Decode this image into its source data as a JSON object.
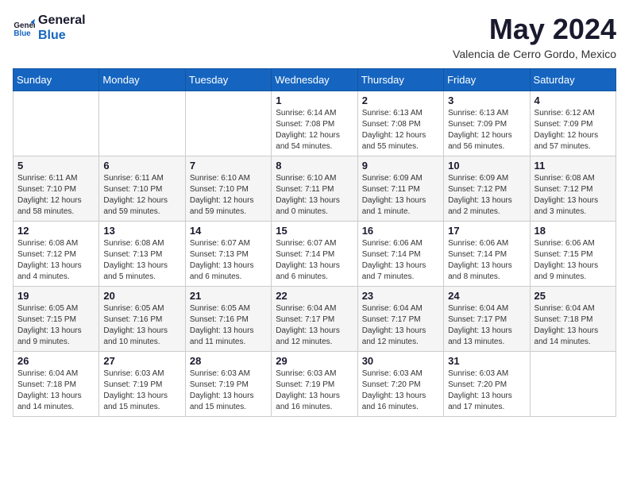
{
  "header": {
    "logo_line1": "General",
    "logo_line2": "Blue",
    "month_title": "May 2024",
    "location": "Valencia de Cerro Gordo, Mexico"
  },
  "days_of_week": [
    "Sunday",
    "Monday",
    "Tuesday",
    "Wednesday",
    "Thursday",
    "Friday",
    "Saturday"
  ],
  "weeks": [
    [
      {
        "day": "",
        "info": ""
      },
      {
        "day": "",
        "info": ""
      },
      {
        "day": "",
        "info": ""
      },
      {
        "day": "1",
        "info": "Sunrise: 6:14 AM\nSunset: 7:08 PM\nDaylight: 12 hours\nand 54 minutes."
      },
      {
        "day": "2",
        "info": "Sunrise: 6:13 AM\nSunset: 7:08 PM\nDaylight: 12 hours\nand 55 minutes."
      },
      {
        "day": "3",
        "info": "Sunrise: 6:13 AM\nSunset: 7:09 PM\nDaylight: 12 hours\nand 56 minutes."
      },
      {
        "day": "4",
        "info": "Sunrise: 6:12 AM\nSunset: 7:09 PM\nDaylight: 12 hours\nand 57 minutes."
      }
    ],
    [
      {
        "day": "5",
        "info": "Sunrise: 6:11 AM\nSunset: 7:10 PM\nDaylight: 12 hours\nand 58 minutes."
      },
      {
        "day": "6",
        "info": "Sunrise: 6:11 AM\nSunset: 7:10 PM\nDaylight: 12 hours\nand 59 minutes."
      },
      {
        "day": "7",
        "info": "Sunrise: 6:10 AM\nSunset: 7:10 PM\nDaylight: 12 hours\nand 59 minutes."
      },
      {
        "day": "8",
        "info": "Sunrise: 6:10 AM\nSunset: 7:11 PM\nDaylight: 13 hours\nand 0 minutes."
      },
      {
        "day": "9",
        "info": "Sunrise: 6:09 AM\nSunset: 7:11 PM\nDaylight: 13 hours\nand 1 minute."
      },
      {
        "day": "10",
        "info": "Sunrise: 6:09 AM\nSunset: 7:12 PM\nDaylight: 13 hours\nand 2 minutes."
      },
      {
        "day": "11",
        "info": "Sunrise: 6:08 AM\nSunset: 7:12 PM\nDaylight: 13 hours\nand 3 minutes."
      }
    ],
    [
      {
        "day": "12",
        "info": "Sunrise: 6:08 AM\nSunset: 7:12 PM\nDaylight: 13 hours\nand 4 minutes."
      },
      {
        "day": "13",
        "info": "Sunrise: 6:08 AM\nSunset: 7:13 PM\nDaylight: 13 hours\nand 5 minutes."
      },
      {
        "day": "14",
        "info": "Sunrise: 6:07 AM\nSunset: 7:13 PM\nDaylight: 13 hours\nand 6 minutes."
      },
      {
        "day": "15",
        "info": "Sunrise: 6:07 AM\nSunset: 7:14 PM\nDaylight: 13 hours\nand 6 minutes."
      },
      {
        "day": "16",
        "info": "Sunrise: 6:06 AM\nSunset: 7:14 PM\nDaylight: 13 hours\nand 7 minutes."
      },
      {
        "day": "17",
        "info": "Sunrise: 6:06 AM\nSunset: 7:14 PM\nDaylight: 13 hours\nand 8 minutes."
      },
      {
        "day": "18",
        "info": "Sunrise: 6:06 AM\nSunset: 7:15 PM\nDaylight: 13 hours\nand 9 minutes."
      }
    ],
    [
      {
        "day": "19",
        "info": "Sunrise: 6:05 AM\nSunset: 7:15 PM\nDaylight: 13 hours\nand 9 minutes."
      },
      {
        "day": "20",
        "info": "Sunrise: 6:05 AM\nSunset: 7:16 PM\nDaylight: 13 hours\nand 10 minutes."
      },
      {
        "day": "21",
        "info": "Sunrise: 6:05 AM\nSunset: 7:16 PM\nDaylight: 13 hours\nand 11 minutes."
      },
      {
        "day": "22",
        "info": "Sunrise: 6:04 AM\nSunset: 7:17 PM\nDaylight: 13 hours\nand 12 minutes."
      },
      {
        "day": "23",
        "info": "Sunrise: 6:04 AM\nSunset: 7:17 PM\nDaylight: 13 hours\nand 12 minutes."
      },
      {
        "day": "24",
        "info": "Sunrise: 6:04 AM\nSunset: 7:17 PM\nDaylight: 13 hours\nand 13 minutes."
      },
      {
        "day": "25",
        "info": "Sunrise: 6:04 AM\nSunset: 7:18 PM\nDaylight: 13 hours\nand 14 minutes."
      }
    ],
    [
      {
        "day": "26",
        "info": "Sunrise: 6:04 AM\nSunset: 7:18 PM\nDaylight: 13 hours\nand 14 minutes."
      },
      {
        "day": "27",
        "info": "Sunrise: 6:03 AM\nSunset: 7:19 PM\nDaylight: 13 hours\nand 15 minutes."
      },
      {
        "day": "28",
        "info": "Sunrise: 6:03 AM\nSunset: 7:19 PM\nDaylight: 13 hours\nand 15 minutes."
      },
      {
        "day": "29",
        "info": "Sunrise: 6:03 AM\nSunset: 7:19 PM\nDaylight: 13 hours\nand 16 minutes."
      },
      {
        "day": "30",
        "info": "Sunrise: 6:03 AM\nSunset: 7:20 PM\nDaylight: 13 hours\nand 16 minutes."
      },
      {
        "day": "31",
        "info": "Sunrise: 6:03 AM\nSunset: 7:20 PM\nDaylight: 13 hours\nand 17 minutes."
      },
      {
        "day": "",
        "info": ""
      }
    ]
  ]
}
